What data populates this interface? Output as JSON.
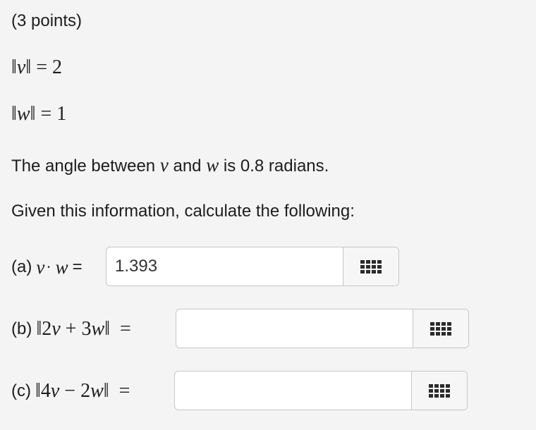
{
  "header": {
    "points": "(3 points)"
  },
  "givens": {
    "norm_v": {
      "var": "v",
      "eq": "= 2"
    },
    "norm_w": {
      "var": "w",
      "eq": "= 1"
    }
  },
  "statement": {
    "prefix": "The angle between",
    "v": "v",
    "and": "and",
    "w": "w",
    "suffix": "is 0.8 radians."
  },
  "instruction": "Given this information, calculate the following:",
  "parts": {
    "a": {
      "label": "(a)",
      "v": "v",
      "dot": "·",
      "w": "w",
      "eq": "=",
      "value": "1.393",
      "placeholder": "",
      "keyboard_icon": "keypad-icon"
    },
    "b": {
      "label": "(b)",
      "expr": "‖2",
      "v": "v",
      "plus": "+ 3",
      "w": "w",
      "close": "‖",
      "eq": "=",
      "value": "",
      "placeholder": "",
      "keyboard_icon": "keypad-icon"
    },
    "c": {
      "label": "(c)",
      "expr": "‖4",
      "v": "v",
      "minus": "− 2",
      "w": "w",
      "close": "‖",
      "eq": "=",
      "value": "",
      "placeholder": "",
      "keyboard_icon": "keypad-icon"
    }
  }
}
